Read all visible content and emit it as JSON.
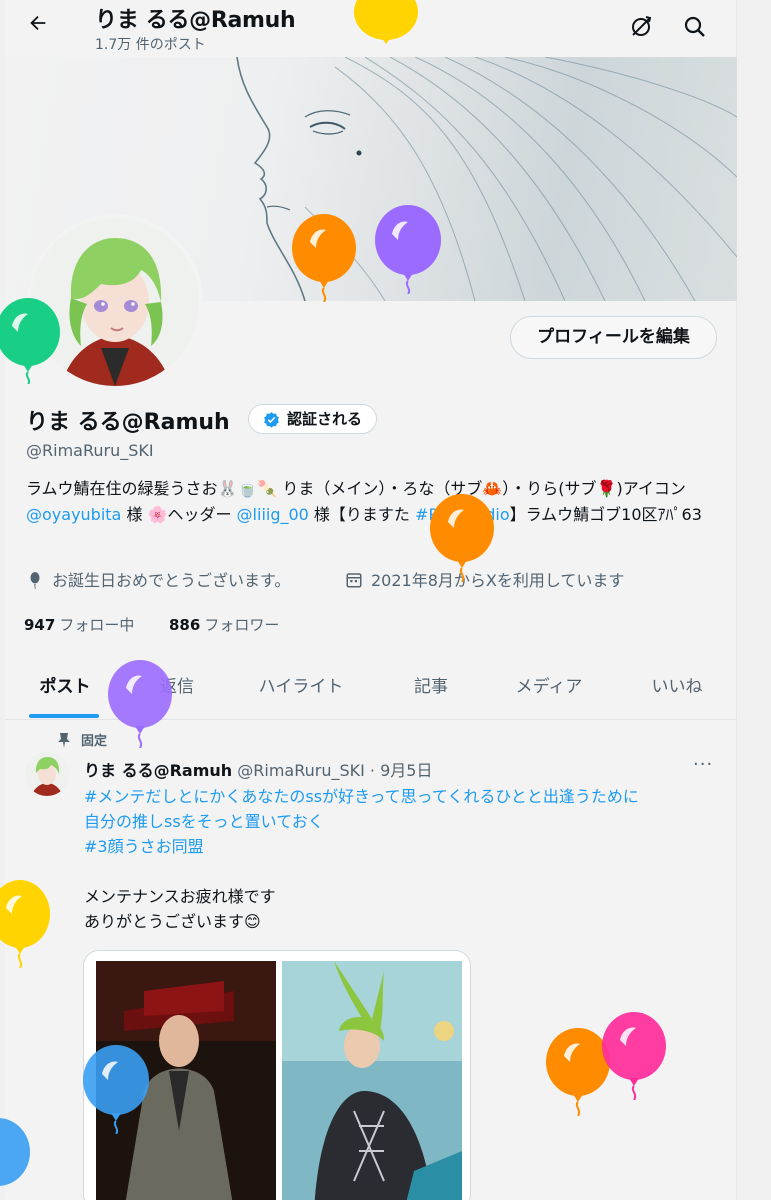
{
  "header": {
    "back_icon": "arrow-left-icon",
    "display_name": "りま るる@Ramuh",
    "post_count": "1.7万 件のポスト",
    "icons": [
      "refresh-off-icon",
      "search-icon"
    ]
  },
  "profile": {
    "edit_button": "プロフィールを編集",
    "display_name": "りま るる@Ramuh",
    "verify_label": "認証される",
    "handle": "@RimaRuru_SKI",
    "bio": {
      "part1": "ラムウ鯖在住の緑髪うさお🐰🍵🍡 りま（メイン）・ろな（サブ🦀）・りら(サブ🌹)アイコン ",
      "link1": "@oyayubita",
      "part2": " 様 🌸ヘッダー ",
      "link2": "@liiig_00",
      "part3": " 様【りますた ",
      "link3": "#RR_Studio",
      "part4": "】ラムウ鯖ゴブ10区ｱﾊﾟ63"
    },
    "location": "お誕生日おめでとうございます。",
    "joined": "2021年8月からXを利用しています",
    "following_count": "947",
    "following_label": "フォロー中",
    "followers_count": "886",
    "followers_label": "フォロワー"
  },
  "tabs": [
    "ポスト",
    "返信",
    "ハイライト",
    "記事",
    "メディア",
    "いいね"
  ],
  "active_tab": "ポスト",
  "pinned_post": {
    "pinned_label": "固定",
    "author_name": "りま るる@Ramuh",
    "author_meta": "@RimaRuru_SKI · 9月5日",
    "more": "···",
    "hashtag_line1": "#メンテだしとにかくあなたのssが好きって思ってくれるひとと出逢うために",
    "hashtag_line2": "自分の推しssをそっと置いておく",
    "hashtag_line3": "#3顔うさお同盟",
    "line4": "メンテナンスお疲れ様です",
    "line5": "ありがとうございます😊"
  },
  "colors": {
    "accent": "#1d9bf0",
    "secondary_text": "#536471",
    "balloon_yellow": "#ffd400",
    "balloon_orange": "#ff8c00",
    "balloon_purple": "#9b6bff",
    "balloon_green": "#19cf86",
    "balloon_blue": "#3a9ff2",
    "balloon_pink": "#ff2d9a"
  }
}
